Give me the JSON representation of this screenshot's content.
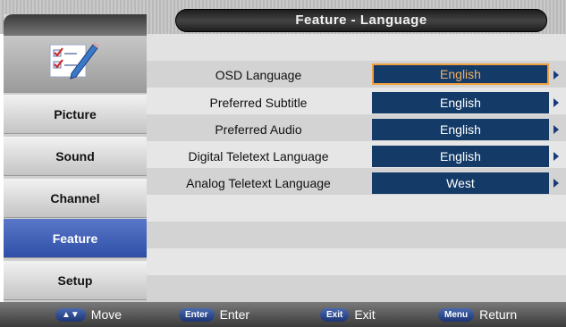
{
  "header": {
    "title": "Feature - Language"
  },
  "sidebar": {
    "items": [
      {
        "label": "Picture",
        "active": false
      },
      {
        "label": "Sound",
        "active": false
      },
      {
        "label": "Channel",
        "active": false
      },
      {
        "label": "Feature",
        "active": true
      },
      {
        "label": "Setup",
        "active": false
      }
    ]
  },
  "settings": [
    {
      "label": "OSD Language",
      "value": "English",
      "selected": true
    },
    {
      "label": "Preferred Subtitle",
      "value": "English",
      "selected": false
    },
    {
      "label": "Preferred Audio",
      "value": "English",
      "selected": false
    },
    {
      "label": "Digital Teletext Language",
      "value": "English",
      "selected": false
    },
    {
      "label": "Analog Teletext Language",
      "value": "West",
      "selected": false
    }
  ],
  "footer": {
    "hints": [
      {
        "key": "▲▼",
        "label": "Move"
      },
      {
        "key": "Enter",
        "label": "Enter"
      },
      {
        "key": "Exit",
        "label": "Exit"
      },
      {
        "key": "Menu",
        "label": "Return"
      }
    ]
  },
  "colors": {
    "accent": "#2f4fa8",
    "value_bg": "#143b68",
    "selected_border": "#f0a040"
  },
  "icons": {
    "logo": "checklist-pencil-icon",
    "row_arrow": "arrow-right-icon"
  }
}
